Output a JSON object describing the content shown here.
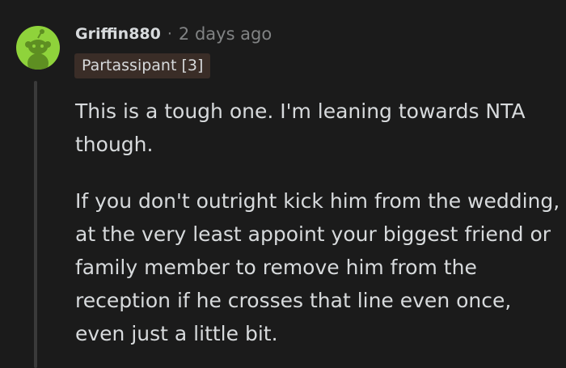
{
  "comment": {
    "author": "Griffin880",
    "separator": "·",
    "timestamp": "2 days ago",
    "flair": "Partassipant [3]",
    "paragraphs": [
      "This is a tough one. I'm leaning towards NTA though.",
      "If you don't outright kick him from the wedding, at the very least appoint your biggest friend or family member to remove him from the reception if he crosses that line even once, even just a little bit."
    ]
  },
  "colors": {
    "background": "#1b1b1b",
    "avatar": "#8fd33b",
    "flair_bg": "#3a2d27",
    "text": "#d7dadc",
    "meta": "#818384"
  },
  "icons": {
    "avatar": "reddit-snoo-avatar-icon"
  }
}
